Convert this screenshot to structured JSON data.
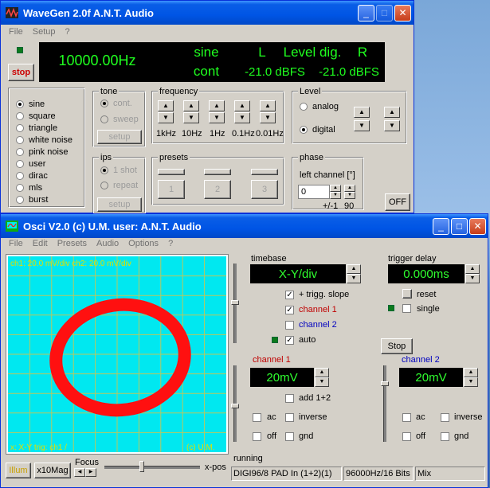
{
  "wavegen": {
    "title": "WaveGen 2.0f  A.N.T. Audio",
    "menu": [
      "File",
      "Setup",
      "?"
    ],
    "stop_label": "stop",
    "display": {
      "frequency": "10000.00Hz",
      "waveform": "sine",
      "mode": "cont",
      "level_title_l": "L",
      "level_title_mid": "Level dig.",
      "level_title_r": "R",
      "level_l": "-21.0 dBFS",
      "level_r": "-21.0 dBFS"
    },
    "waveforms": [
      "sine",
      "square",
      "triangle",
      "white noise",
      "pink noise",
      "user",
      "dirac",
      "mls",
      "burst"
    ],
    "waveform_selected": "sine",
    "tone": {
      "title": "tone",
      "options": [
        "cont.",
        "sweep"
      ],
      "setup": "setup"
    },
    "ips": {
      "title": "ips",
      "options": [
        "1 shot",
        "repeat"
      ],
      "setup": "setup"
    },
    "frequency": {
      "title": "frequency",
      "steps": [
        "1kHz",
        "10Hz",
        "1Hz",
        "0.1Hz",
        "0.01Hz"
      ]
    },
    "presets": {
      "title": "presets",
      "buttons": [
        "1",
        "2",
        "3"
      ]
    },
    "level": {
      "title": "Level",
      "options": [
        "analog",
        "digital"
      ],
      "selected": "digital"
    },
    "phase": {
      "title": "phase",
      "label": "left channel [°]",
      "value": "0",
      "pm": "+/-1",
      "pm_val": "90"
    },
    "off_label": "OFF"
  },
  "osci": {
    "title": "Osci V2.0  (c) U.M.  user: A.N.T. Audio",
    "menu": [
      "File",
      "Edit",
      "Presets",
      "Audio",
      "Options",
      "?"
    ],
    "screen": {
      "top_text": "ch1: 20.0 mV/div  ch2: 20.0 mV/div",
      "bottom_left": "x: X-Y  trig: ch1 /",
      "bottom_right": "(c) U.M."
    },
    "timebase": {
      "title": "timebase",
      "value": "X-Y/div",
      "trigg_slope": "+ trigg. slope",
      "channel1": "channel 1",
      "channel2": "channel 2",
      "auto": "auto"
    },
    "trigger_delay": {
      "title": "trigger delay",
      "value": "0.000ms",
      "reset": "reset",
      "single": "single",
      "stop": "Stop"
    },
    "ch1": {
      "title": "channel 1",
      "value": "20mV",
      "add": "add 1+2",
      "ac": "ac",
      "inverse": "inverse",
      "off": "off",
      "gnd": "gnd"
    },
    "ch2": {
      "title": "channel 2",
      "value": "20mV",
      "ac": "ac",
      "inverse": "inverse",
      "off": "off",
      "gnd": "gnd"
    },
    "bottom": {
      "illum": "Illum",
      "x10mag": "x10Mag",
      "focus": "Focus",
      "xpos": "x-pos"
    },
    "status": {
      "state": "running",
      "device": "DIGI96/8 PAD In (1+2)(1)",
      "format": "96000Hz/16 Bits",
      "mix": "Mix"
    }
  },
  "colors": {
    "lcd_green": "#1fff1f",
    "screen_bg": "#00e8f0",
    "trace": "#ff1010",
    "ch1": "#c00000",
    "ch2": "#0000c0",
    "title_blue": "#0055e5"
  }
}
